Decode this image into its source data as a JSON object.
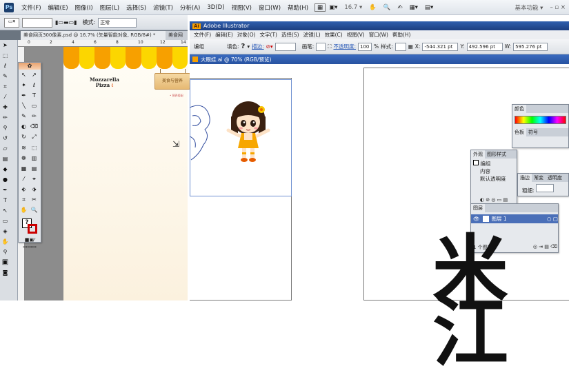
{
  "ps": {
    "logo": "Ps",
    "menus": [
      "文件(F)",
      "编辑(E)",
      "图像(I)",
      "图层(L)",
      "选择(S)",
      "滤镜(T)",
      "分析(A)",
      "3D(D)",
      "视图(V)",
      "窗口(W)",
      "帮助(H)"
    ],
    "zoom": "16.7",
    "workspace": "基本功能 ▾",
    "win_controls": "– ▫ ×",
    "mode_label": "模式:",
    "mode_value": "正常",
    "doc_tab": "美食网页300像素.psd @ 16.7% (矢量智能对象, RGB/8#) *",
    "doc_tab_close": "×",
    "doc_tab2": "美食网",
    "ruler_marks": [
      "0",
      "2",
      "4",
      "6",
      "8",
      "10",
      "12",
      "14"
    ],
    "pizza_title": "Mozzarella",
    "pizza_sub": "Pizza",
    "pizza_mark": "ℓ",
    "sign_text": "美食与营养",
    "sign_small": "• 营养搭配"
  },
  "ai": {
    "logo": "Ai",
    "title": "Adobe Illustrator",
    "menus": [
      "文件(F)",
      "编辑(E)",
      "对象(O)",
      "文字(T)",
      "选择(S)",
      "滤镜(L)",
      "效果(C)",
      "视图(V)",
      "窗口(W)",
      "帮助(H)"
    ],
    "ctrl_group": "编组",
    "ctrl_fill": "填色:",
    "ctrl_stroke": "描边:",
    "ctrl_brush": "画笔:",
    "ctrl_opacity_label": "不透明度:",
    "ctrl_opacity": "100",
    "ctrl_percent": "%",
    "ctrl_style": "样式:",
    "x_label": "X:",
    "x_value": "-544.321 pt",
    "y_label": "Y:",
    "y_value": "492.596 pt",
    "w_label": "W:",
    "w_value": "595.276 pt",
    "doc_tab": "大眼娃.ai @ 70% (RGB/预览)",
    "color_panel": {
      "tab": "颜色",
      "tabs": [
        "色板",
        "符号"
      ]
    },
    "appearance_panel": {
      "tabs": [
        "外观",
        "图形样式"
      ],
      "group": "编组",
      "content": "内容",
      "opacity": "默认透明度"
    },
    "stroke_panel": {
      "tabs": [
        "描边",
        "渐变",
        "透明度"
      ],
      "weight": "粗细:"
    },
    "layers_panel": {
      "title": "图层",
      "layer": "图层 1",
      "footer": "1 个图层"
    }
  },
  "colors": {
    "awning": [
      "#f7a000",
      "#fcd600",
      "#f7a000",
      "#fcd600",
      "#f7a000",
      "#fcd600",
      "#f7a000",
      "#fcd600"
    ]
  },
  "watermark": "米江"
}
